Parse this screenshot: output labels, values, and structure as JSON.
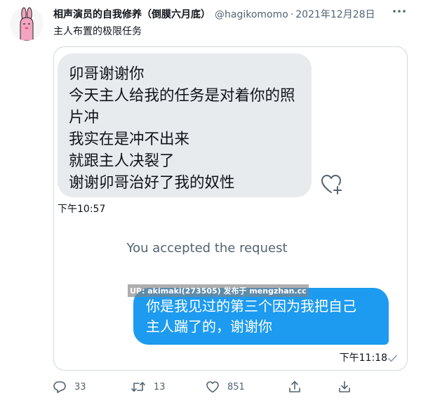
{
  "tweet": {
    "display_name": "相声演员的自我修养（倒膜六月底）",
    "handle": "@hagikomomo",
    "separator": "·",
    "date": "2021年12月28日",
    "text": "主人布置的极限任务"
  },
  "screenshot": {
    "incoming_lines": [
      "卯哥谢谢你",
      "今天主人给我的任务是对着你的照",
      "片冲",
      "我实在是冲不出来",
      "就跟主人决裂了",
      "谢谢卯哥治好了我的奴性"
    ],
    "incoming_time": "下午10:57",
    "system_message": "You accepted the request",
    "outgoing_lines": [
      "你是我见过的第三个因为我把自己",
      "主人踹了的，谢谢你"
    ],
    "outgoing_time": "下午11:18",
    "watermark": "UP: akimaki(273505) 发布于 mengzhan.cc"
  },
  "actions": {
    "reply_count": "33",
    "retweet_count": "13",
    "like_count": "851"
  },
  "colors": {
    "accent": "#1d9bf0",
    "incoming_bubble": "#e8ebee",
    "muted_text": "#536471"
  },
  "icons": [
    "more-icon",
    "heart-plus-icon",
    "check-icon",
    "reply-icon",
    "retweet-icon",
    "like-icon",
    "share-icon",
    "download-icon"
  ]
}
